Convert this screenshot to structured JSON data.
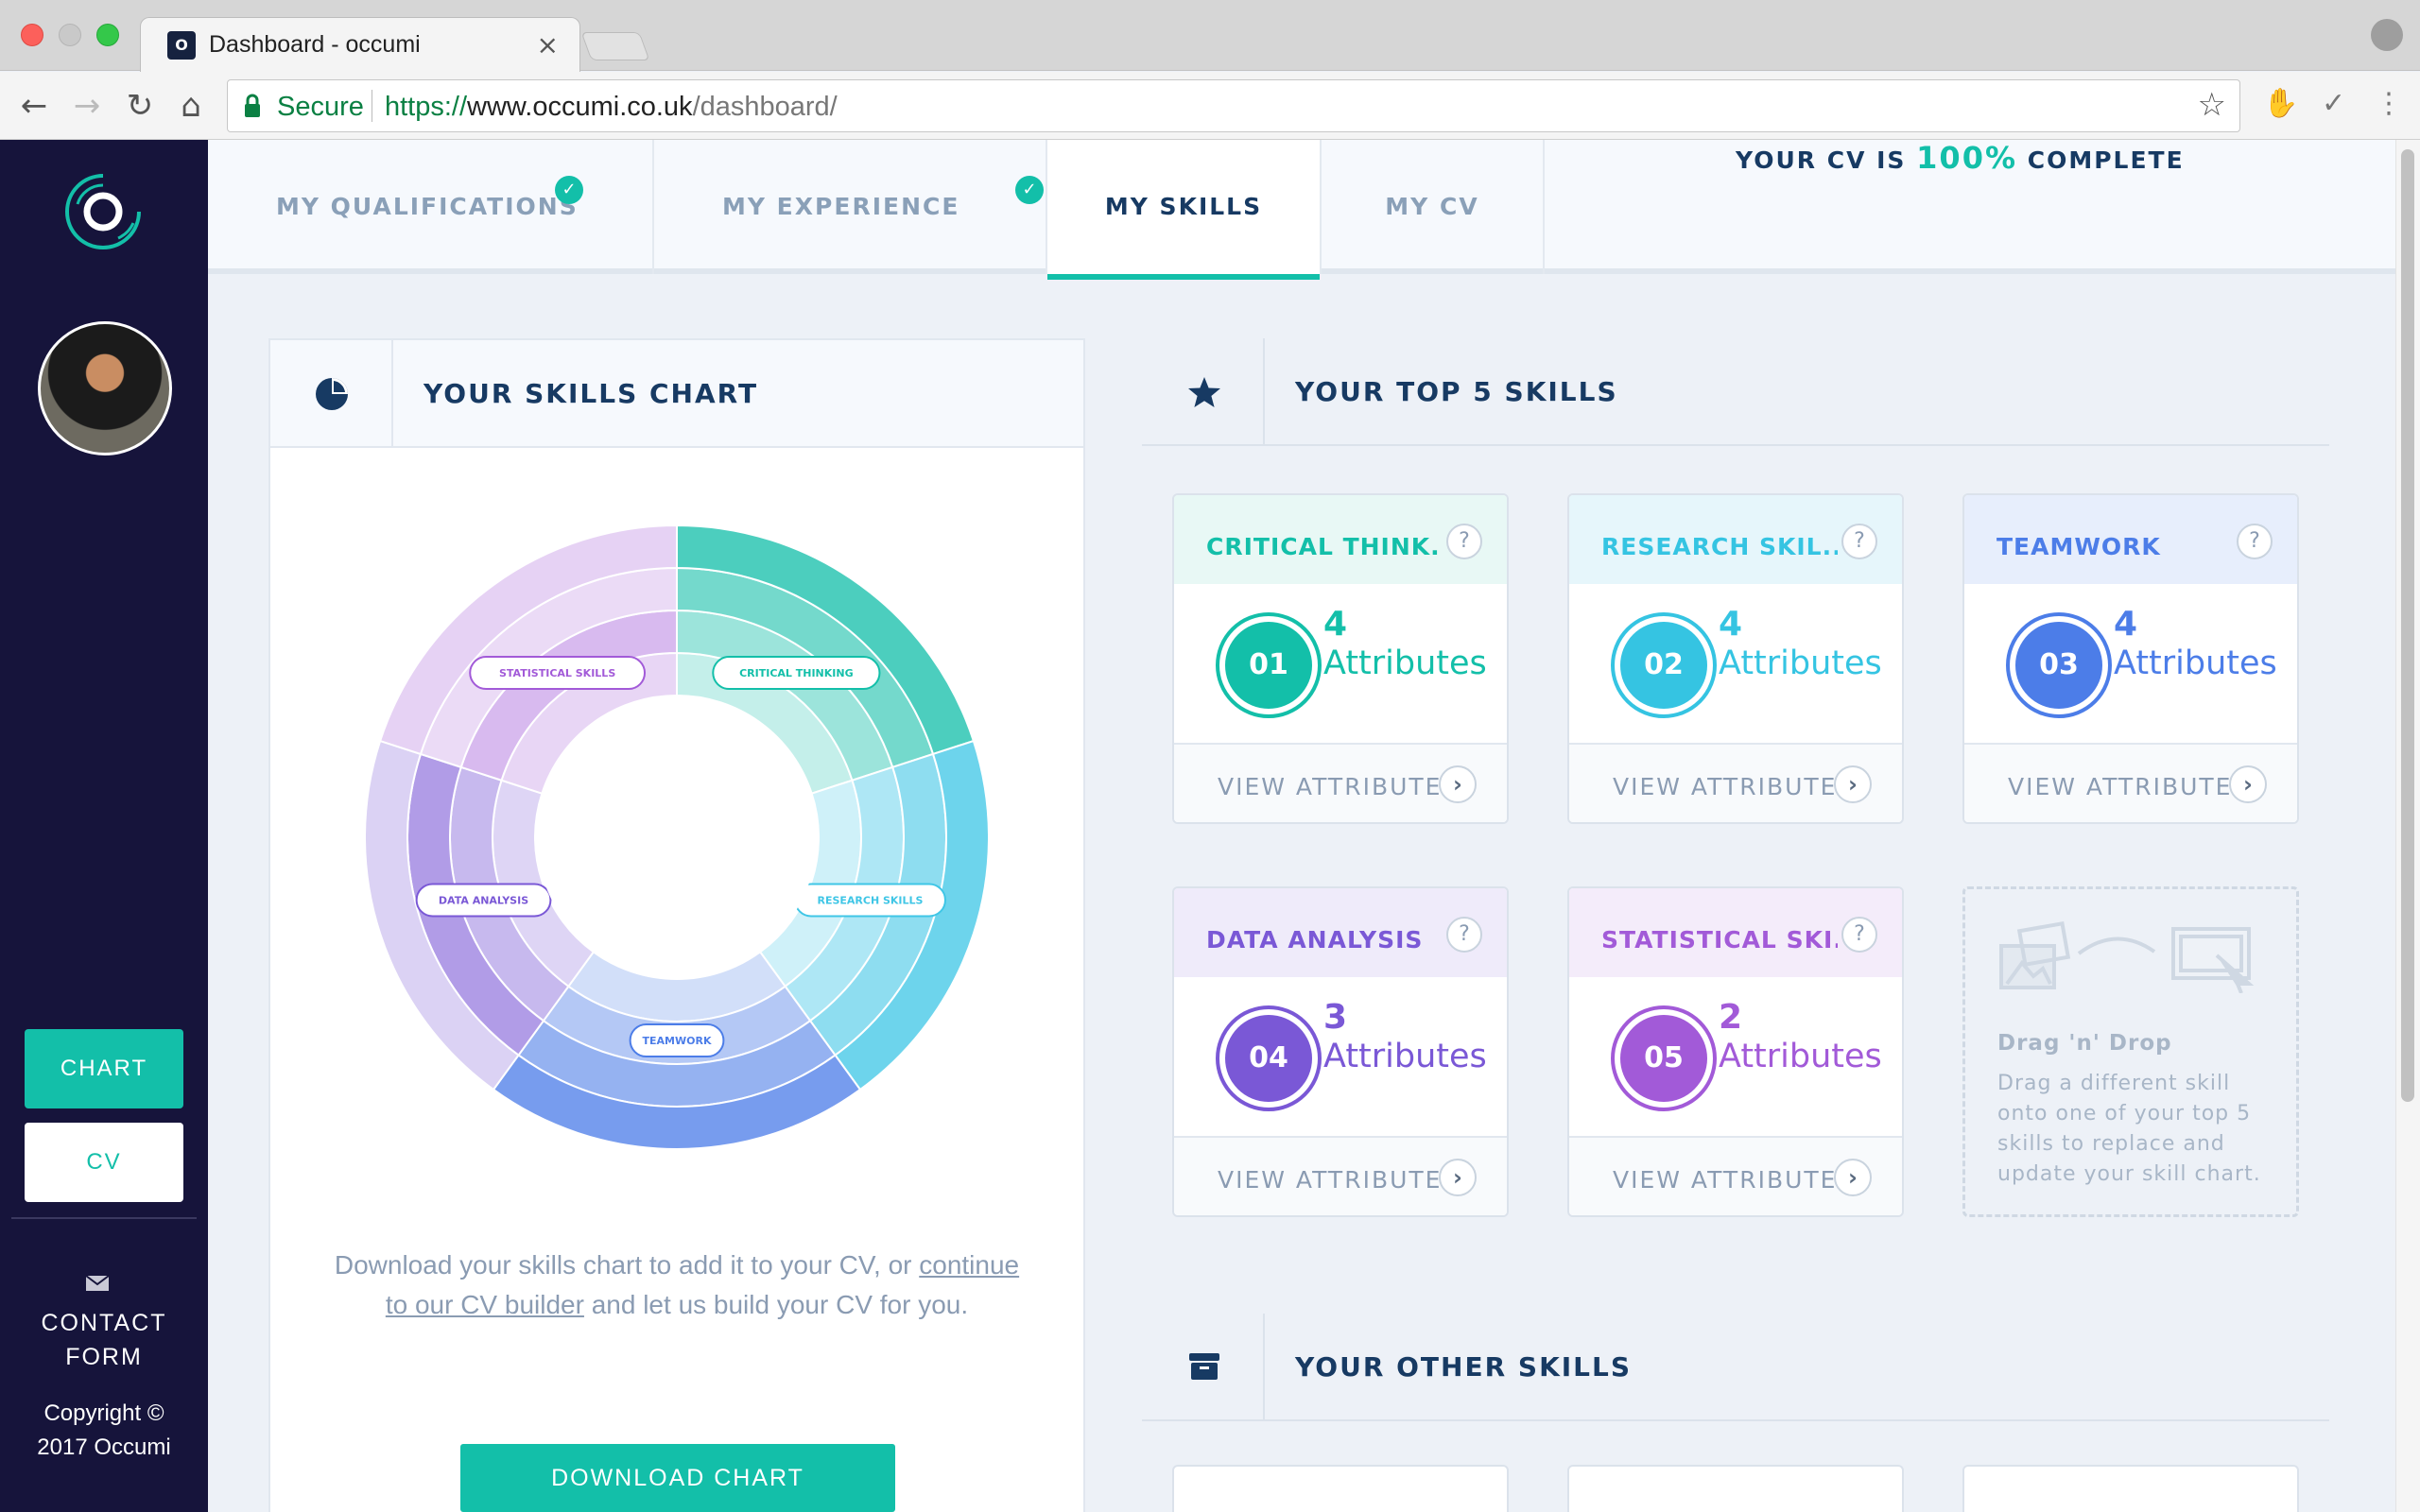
{
  "browser": {
    "tab_title": "Dashboard - occumi",
    "tab_close": "×",
    "favicon_letter": "O",
    "secure_label": "Secure",
    "url_scheme": "https://",
    "url_host": "www.occumi.co.uk",
    "url_path": "/dashboard/"
  },
  "sidebar": {
    "chart_label": "CHART",
    "cv_label": "CV",
    "contact_line1": "CONTACT",
    "contact_line2": "FORM",
    "copyright_line1": "Copyright ©",
    "copyright_line2": "2017 Occumi"
  },
  "nav": {
    "qualifications": "MY QUALIFICATIONS",
    "experience": "MY EXPERIENCE",
    "skills": "MY SKILLS",
    "cv": "MY CV",
    "complete_prefix": "YOUR CV IS",
    "complete_pct": "100%",
    "complete_suffix": "COMPLETE"
  },
  "chart_panel": {
    "title": "YOUR SKILLS CHART",
    "text_before": "Download your skills chart to add it to your CV, or ",
    "link": "continue to our CV builder",
    "text_after": " and let us build your CV for you.",
    "download_label": "DOWNLOAD CHART"
  },
  "chart_data": {
    "type": "pie",
    "categories": [
      "CRITICAL THINKING",
      "RESEARCH SKILLS",
      "TEAMWORK",
      "DATA ANALYSIS",
      "STATISTICAL SKILLS"
    ],
    "values": [
      4,
      4,
      4,
      3,
      2
    ],
    "colors": [
      "#13bfa9",
      "#3fc6e6",
      "#4c7de8",
      "#7a58d6",
      "#a25ad8"
    ]
  },
  "top5": {
    "title": "YOUR TOP 5 SKILLS",
    "view_label": "VIEW ATTRIBUTES",
    "attr_label": "Attributes",
    "skills": [
      {
        "name": "CRITICAL THINK...",
        "num": "01",
        "count": "4",
        "color": "#13bfa9",
        "head_bg": "#e8f8f5"
      },
      {
        "name": "RESEARCH SKIL...",
        "num": "02",
        "count": "4",
        "color": "#35c4e2",
        "head_bg": "#e6f6fb"
      },
      {
        "name": "TEAMWORK",
        "num": "03",
        "count": "4",
        "color": "#4c7de8",
        "head_bg": "#e7eefc"
      },
      {
        "name": "DATA ANALYSIS",
        "num": "04",
        "count": "3",
        "color": "#7a58d6",
        "head_bg": "#efebfa"
      },
      {
        "name": "STATISTICAL SKI...",
        "num": "05",
        "count": "2",
        "color": "#a25ad8",
        "head_bg": "#f4ecfa"
      }
    ],
    "drop_title": "Drag 'n' Drop",
    "drop_text": "Drag a different skill onto one of your top 5 skills to replace and update your skill chart."
  },
  "other": {
    "title": "YOUR OTHER SKILLS"
  },
  "icons": {
    "help": "?",
    "arrow": "›",
    "check": "✓"
  }
}
